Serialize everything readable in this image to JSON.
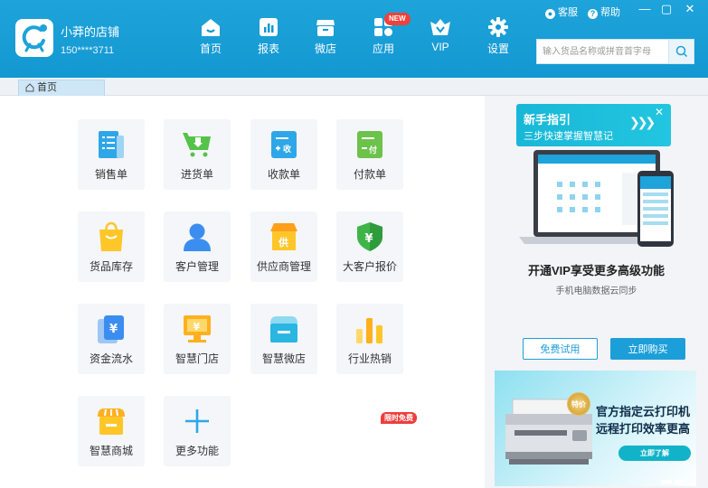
{
  "header": {
    "store_name": "小莽的店铺",
    "phone": "150****3711",
    "kefu": "客服",
    "help": "帮助",
    "window": {
      "minimize": "—",
      "maximize": "▢",
      "close": "✕"
    },
    "nav": [
      {
        "label": "首页",
        "icon": "home-icon"
      },
      {
        "label": "报表",
        "icon": "report-icon"
      },
      {
        "label": "微店",
        "icon": "shop-icon"
      },
      {
        "label": "应用",
        "icon": "apps-icon",
        "badge": "NEW"
      },
      {
        "label": "VIP",
        "icon": "vip-icon"
      },
      {
        "label": "设置",
        "icon": "gear-icon"
      }
    ],
    "search_placeholder": "输入货品名称或拼音首字母"
  },
  "tabs": [
    {
      "label": "首页",
      "icon": "home-icon"
    }
  ],
  "tiles": [
    {
      "label": "销售单",
      "icon": "sales-order-icon",
      "color": "#2ea7e8"
    },
    {
      "label": "进货单",
      "icon": "purchase-cart-icon",
      "color": "#55c24a"
    },
    {
      "label": "收款单",
      "icon": "receipt-icon",
      "color": "#2ea7e8",
      "glyph": "收"
    },
    {
      "label": "付款单",
      "icon": "payment-icon",
      "color": "#6cc24a",
      "glyph": "付"
    },
    {
      "label": "货品库存",
      "icon": "inventory-bag-icon",
      "color": "#ffc62a"
    },
    {
      "label": "客户管理",
      "icon": "customer-icon",
      "color": "#3b8ef0"
    },
    {
      "label": "供应商管理",
      "icon": "supplier-icon",
      "color": "#ff9f1c",
      "glyph": "供"
    },
    {
      "label": "大客户报价",
      "icon": "shield-yen-icon",
      "color": "#3fb549",
      "glyph": "¥"
    },
    {
      "label": "资金流水",
      "icon": "cash-flow-icon",
      "color": "#3b8ef0",
      "glyph": "¥"
    },
    {
      "label": "智慧门店",
      "icon": "smart-store-icon",
      "color": "#ffb01f",
      "glyph": "¥"
    },
    {
      "label": "智慧微店",
      "icon": "smart-microshop-icon",
      "color": "#29b6e3"
    },
    {
      "label": "行业热销",
      "icon": "bar-chart-icon",
      "color": "#ffb01f",
      "badge": "限时免费"
    },
    {
      "label": "智慧商城",
      "icon": "smart-mall-icon",
      "color": "#ffb01f"
    },
    {
      "label": "更多功能",
      "icon": "plus-icon",
      "color": "#2ea7e8"
    }
  ],
  "sidebar": {
    "guide_title": "新手指引",
    "guide_sub": "三步快速掌握智慧记",
    "guide_arrow": "❯❯❯",
    "guide_close": "✕",
    "vip_title": "开通VIP享受更多高级功能",
    "vip_sub": "手机电脑数据云同步",
    "trial_label": "免费试用",
    "buy_label": "立即购买",
    "banner": {
      "badge": "特价",
      "line1": "官方指定云打印机",
      "line2": "远程打印效率更高",
      "button": "立即了解"
    }
  },
  "colors": {
    "header": "#1398d1",
    "accent": "#1c9fd9",
    "tile_bg": "#f4f6f9"
  }
}
